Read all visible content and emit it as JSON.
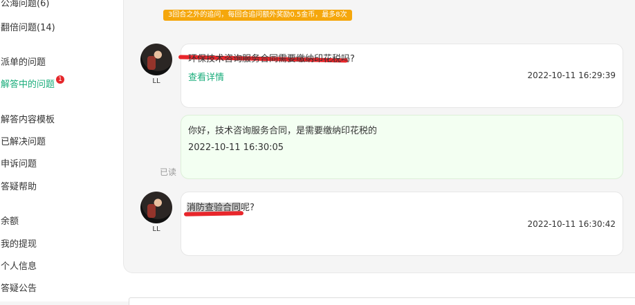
{
  "sidebar": {
    "items": [
      {
        "label": "公海问题(6)"
      },
      {
        "label": "翻倍问题(14)"
      },
      {
        "label": "派单的问题"
      },
      {
        "label": "解答中的问题",
        "badge": "1"
      },
      {
        "label": "解答内容模板"
      },
      {
        "label": "已解决问题"
      },
      {
        "label": "申诉问题"
      },
      {
        "label": "答疑帮助"
      },
      {
        "label": "余额"
      },
      {
        "label": "我的提现"
      },
      {
        "label": "个人信息"
      },
      {
        "label": "答疑公告"
      }
    ]
  },
  "notice": "3回合之外的追问，每回合追问额外奖励0.5金币，最多8次",
  "messages": [
    {
      "user": "LL",
      "question": "环保技术咨询服务合同需要缴纳印花税吗?",
      "link": "查看详情",
      "timestamp": "2022-10-11 16:29:39"
    },
    {
      "reply": "你好，技术咨询服务合同，是需要缴纳印花税的",
      "timestamp": "2022-10-11 16:30:05",
      "status": "已读"
    },
    {
      "user": "LL",
      "question_highlight": "消防查验合同",
      "question_rest": "呢?",
      "timestamp": "2022-10-11 16:30:42"
    }
  ],
  "colors": {
    "accent": "#1aad7b",
    "notice": "#f5a70c",
    "badge": "#e5262a",
    "markup": "#e8262b"
  }
}
